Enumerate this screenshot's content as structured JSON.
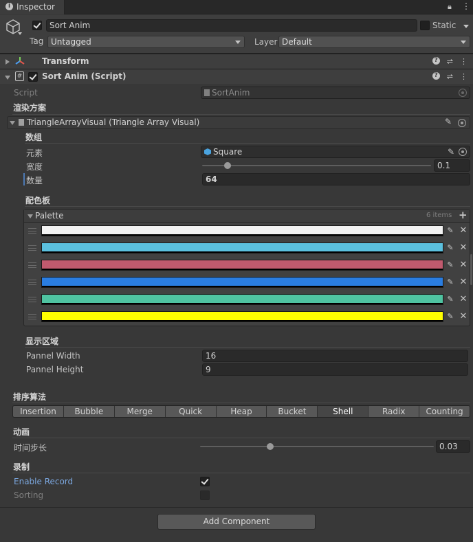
{
  "window": {
    "tab_title": "Inspector"
  },
  "object": {
    "name": "Sort Anim",
    "active": true,
    "static_label": "Static",
    "tag_label": "Tag",
    "tag_value": "Untagged",
    "layer_label": "Layer",
    "layer_value": "Default"
  },
  "components": {
    "transform": {
      "title": "Transform"
    },
    "script_component": {
      "title": "Sort Anim (Script)",
      "enabled": true
    }
  },
  "script": {
    "label": "Script",
    "value": "SortAnim"
  },
  "render_scheme": {
    "title": "渲染方案",
    "object_field": "TriangleArrayVisual (Triangle Array Visual)"
  },
  "array_group": {
    "title": "数组",
    "element_label": "元素",
    "element_value": "Square",
    "width_label": "宽度",
    "width_value": "0.1",
    "width_fraction": 0.11,
    "count_label": "数量",
    "count_value": "64"
  },
  "palette_group": {
    "title": "配色板",
    "list_title": "Palette",
    "count": "6 items",
    "colors": [
      "#f2f2f2",
      "#5bc0de",
      "#c05a6e",
      "#2a7de1",
      "#4fc3a1",
      "#ffff00"
    ]
  },
  "display_area": {
    "title": "显示区域",
    "width_label": "Pannel Width",
    "width_value": "16",
    "height_label": "Pannel Height",
    "height_value": "9"
  },
  "sort_algorithm": {
    "title": "排序算法",
    "options": [
      "Insertion",
      "Bubble",
      "Merge",
      "Quick",
      "Heap",
      "Bucket",
      "Shell",
      "Radix",
      "Counting"
    ],
    "selected": "Shell"
  },
  "animation": {
    "title": "动画",
    "step_label": "时间步长",
    "step_value": "0.03",
    "step_fraction": 0.3
  },
  "recording": {
    "title": "录制",
    "enable_label": "Enable Record",
    "enable_checked": true,
    "sorting_label": "Sorting",
    "sorting_checked": false
  },
  "add_component_label": "Add Component"
}
